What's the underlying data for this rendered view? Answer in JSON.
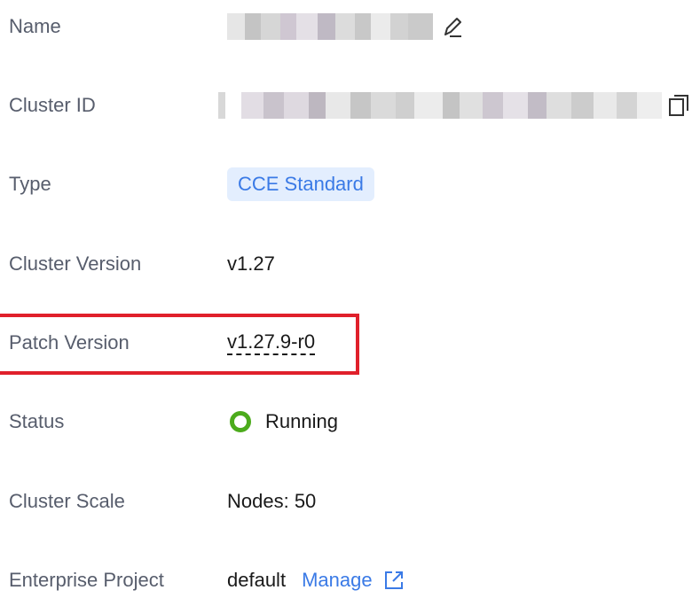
{
  "fields": {
    "name": {
      "label": "Name"
    },
    "cluster_id": {
      "label": "Cluster ID"
    },
    "type": {
      "label": "Type",
      "value": "CCE Standard"
    },
    "cluster_version": {
      "label": "Cluster Version",
      "value": "v1.27"
    },
    "patch_version": {
      "label": "Patch Version",
      "value": "v1.27.9-r0"
    },
    "status": {
      "label": "Status",
      "value": "Running",
      "color": "#4cab1c"
    },
    "cluster_scale": {
      "label": "Cluster Scale",
      "value": "Nodes: 50"
    },
    "enterprise_project": {
      "label": "Enterprise Project",
      "value": "default",
      "link": "Manage"
    }
  },
  "icons": {
    "name_edit": "pencil-icon",
    "cluster_id_copy": "copy-icon",
    "manage_link": "external-link-icon"
  },
  "colors": {
    "accent": "#3a7ae6",
    "badge_bg": "#e3eefe",
    "highlight": "#e0202b",
    "status_running": "#4cab1c"
  }
}
